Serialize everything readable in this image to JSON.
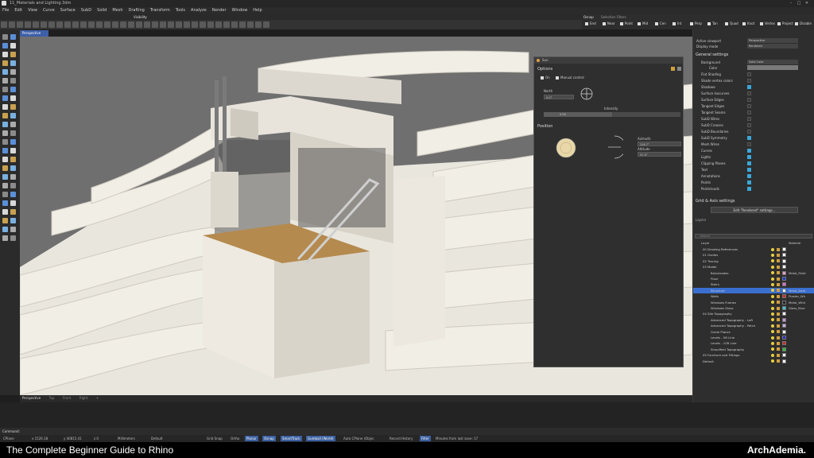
{
  "window": {
    "title": "11_Materials and Lighting.3dm",
    "controls": [
      "–",
      "□",
      "✕"
    ]
  },
  "menu": [
    "File",
    "Edit",
    "View",
    "Curve",
    "Surface",
    "SubD",
    "Solid",
    "Mesh",
    "Drafting",
    "Transform",
    "Tools",
    "Analyze",
    "Render",
    "Window",
    "Help"
  ],
  "toolbar_tabs": {
    "active": "Visibility"
  },
  "osnap": {
    "tabs": [
      "Osnap",
      "Selection Filters"
    ],
    "items": [
      "End",
      "Near",
      "Point",
      "Mid",
      "Cen",
      "Int",
      "Perp",
      "Tan",
      "Quad",
      "Knot",
      "Vertex",
      "Project",
      "Disable"
    ]
  },
  "viewport": {
    "active_tab": "Perspective",
    "bottom_tabs": [
      "Perspective",
      "Top",
      "Front",
      "Right"
    ],
    "add_tab": "+"
  },
  "sun_dialog": {
    "title": "Sun",
    "options_label": "Options",
    "on_label": "On",
    "manual_label": "Manual control",
    "north_label": "North",
    "north_value": "0.0°",
    "intensity_label": "Intensity",
    "intensity_value": "0.50",
    "position_label": "Position",
    "azimuth_label": "Azimuth",
    "azimuth_value": "226.7°",
    "altitude_label": "Altitude",
    "altitude_value": "57.0°"
  },
  "properties": {
    "active_viewport_label": "Active viewport",
    "active_viewport_value": "Perspective",
    "display_mode_label": "Display mode",
    "display_mode_value": "Rendered",
    "general_settings": "General settings",
    "background_label": "Background",
    "background_value": "Solid Color",
    "color_label": "Color",
    "checkbox_rows": [
      {
        "label": "Flat Shading",
        "on": false
      },
      {
        "label": "Shade vertex colors",
        "on": false
      },
      {
        "label": "Shadows",
        "on": true
      },
      {
        "label": "Surface Isocurves",
        "on": false
      },
      {
        "label": "Surface Edges",
        "on": false
      },
      {
        "label": "Tangent Edges",
        "on": false
      },
      {
        "label": "Tangent Seams",
        "on": false
      },
      {
        "label": "SubD Wires",
        "on": false
      },
      {
        "label": "SubD Creases",
        "on": false
      },
      {
        "label": "SubD Boundaries",
        "on": false
      },
      {
        "label": "SubD Symmetry",
        "on": true
      },
      {
        "label": "Mesh Wires",
        "on": false
      },
      {
        "label": "Curves",
        "on": true
      },
      {
        "label": "Lights",
        "on": true
      },
      {
        "label": "Clipping Planes",
        "on": true
      },
      {
        "label": "Text",
        "on": true
      },
      {
        "label": "Annotations",
        "on": true
      },
      {
        "label": "Points",
        "on": true
      },
      {
        "label": "Pointclouds",
        "on": true
      }
    ],
    "grid_settings": "Grid & Axis settings",
    "edit_button": "Edit \"Rendered\" settings..."
  },
  "layers": {
    "panel_title": "Layers",
    "search_placeholder": "Search",
    "col_layer": "Layer",
    "col_material": "Material",
    "rows": [
      {
        "name": "00 Drawing References",
        "indent": 1,
        "color": "#ffffff",
        "selected": false,
        "material": ""
      },
      {
        "name": "01 Guides",
        "indent": 1,
        "color": "#ffffff",
        "selected": false,
        "material": ""
      },
      {
        "name": "02 Tracing",
        "indent": 1,
        "color": "#ffffff",
        "selected": false,
        "material": ""
      },
      {
        "name": "03 Model",
        "indent": 1,
        "color": "#ffffff",
        "selected": false,
        "material": ""
      },
      {
        "name": "Balustrades",
        "indent": 2,
        "color": "#e6a0c8",
        "selected": false,
        "material": "Metal_Paint"
      },
      {
        "name": "Floor",
        "indent": 2,
        "color": "#1a3ad8",
        "selected": false,
        "material": ""
      },
      {
        "name": "Stairs",
        "indent": 2,
        "color": "#e06ad0",
        "selected": false,
        "material": ""
      },
      {
        "name": "Structure",
        "indent": 2,
        "color": "#ffffff",
        "selected": true,
        "material": "Metal_Dark"
      },
      {
        "name": "Walls",
        "indent": 2,
        "color": "#d02a2a",
        "selected": false,
        "material": "Plaster_Wh"
      },
      {
        "name": "Windows Frames",
        "indent": 2,
        "color": "#222222",
        "selected": false,
        "material": "Metal_Whit"
      },
      {
        "name": "Windows Glass",
        "indent": 2,
        "color": "#35c8d8",
        "selected": false,
        "material": "Glass_Blue"
      },
      {
        "name": "04 Site Topography",
        "indent": 1,
        "color": "#ffffff",
        "selected": false,
        "material": ""
      },
      {
        "name": "Advanced Topography - Loft",
        "indent": 2,
        "color": "#c89ad8",
        "selected": false,
        "material": ""
      },
      {
        "name": "Advanced Topography - Patch",
        "indent": 2,
        "color": "#c8b0e0",
        "selected": false,
        "material": ""
      },
      {
        "name": "Guide Planes",
        "indent": 2,
        "color": "#ffffff",
        "selected": false,
        "material": ""
      },
      {
        "name": "Levels - 5ft Line",
        "indent": 2,
        "color": "#2a2ad0",
        "selected": false,
        "material": ""
      },
      {
        "name": "Levels - 10ft Line",
        "indent": 2,
        "color": "#d02a2a",
        "selected": false,
        "material": ""
      },
      {
        "name": "Simplified Topography",
        "indent": 2,
        "color": "#2ac02a",
        "selected": false,
        "material": ""
      },
      {
        "name": "05 Furniture and Fittings",
        "indent": 1,
        "color": "#ffffff",
        "selected": false,
        "material": ""
      },
      {
        "name": "Default",
        "indent": 1,
        "color": "#ffffff",
        "selected": false,
        "material": ""
      }
    ]
  },
  "command": {
    "label": "Command:"
  },
  "status": {
    "cplane": "CPlane",
    "x": "x 1526.18",
    "y": "y 40815.41",
    "z": "z 0",
    "units": "Millimeters",
    "layer": "Default",
    "grid_snap": "Grid Snap",
    "ortho": "Ortho",
    "planar": "Planar",
    "osnap": "Osnap",
    "smarttrack": "SmartTrack",
    "gumball": "Gumball (World)",
    "autocplane": "Auto CPlane (Objec",
    "record_history": "Record History",
    "filter": "Filter",
    "minutes": "Minutes from last save: 17"
  },
  "caption": {
    "title": "The Complete Beginner Guide to Rhino",
    "brand": "ArchAdemia."
  },
  "colors": {
    "accent": "#3a6fd0",
    "checkbox_on": "#3ba7d9"
  }
}
